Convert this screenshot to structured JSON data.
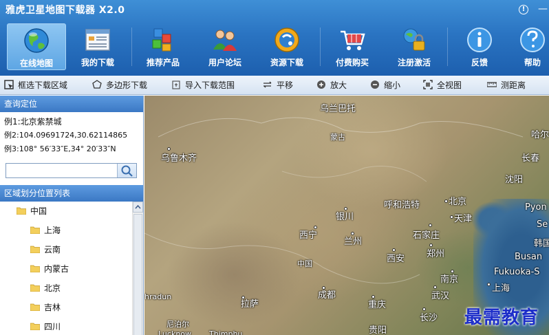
{
  "app": {
    "title": "雅虎卫星地图下载器 X2.0",
    "info_symbol": "!",
    "min_symbol": "—"
  },
  "toolbar": {
    "items": [
      {
        "label": "在线地图",
        "icon": "globe-icon",
        "active": true
      },
      {
        "label": "我的下载",
        "icon": "download-list-icon"
      },
      {
        "label": "推荐产品",
        "icon": "cubes-icon"
      },
      {
        "label": "用户论坛",
        "icon": "users-icon"
      },
      {
        "label": "资源下载",
        "icon": "resource-icon"
      },
      {
        "label": "付费购买",
        "icon": "cart-icon"
      },
      {
        "label": "注册激活",
        "icon": "register-lock-icon"
      },
      {
        "label": "反馈",
        "icon": "info-icon"
      },
      {
        "label": "帮助",
        "icon": "help-icon"
      }
    ]
  },
  "maptools": {
    "items": [
      {
        "label": "框选下载区域",
        "icon": "box-select-icon"
      },
      {
        "label": "多边形下载",
        "icon": "polygon-icon"
      },
      {
        "label": "导入下载范围",
        "icon": "import-icon"
      },
      {
        "label": "平移",
        "icon": "pan-icon"
      },
      {
        "label": "放大",
        "icon": "zoom-in-icon"
      },
      {
        "label": "缩小",
        "icon": "zoom-out-icon"
      },
      {
        "label": "全视图",
        "icon": "full-view-icon"
      },
      {
        "label": "测距离",
        "icon": "ruler-icon"
      }
    ]
  },
  "query": {
    "title": "查询定位",
    "ex1": "例1:北京紫禁城",
    "ex2": "例2:104.09691724,30.62114865",
    "ex3": "例3:108° 56′33″E,34° 20′33″N",
    "search_value": ""
  },
  "region": {
    "title": "区域划分位置列表",
    "root": "中国",
    "children": [
      "上海",
      "云南",
      "内蒙古",
      "北京",
      "吉林",
      "四川"
    ]
  },
  "map": {
    "labels": [
      "乌兰巴托",
      "蒙古",
      "哈尔",
      "乌鲁木齐",
      "长春",
      "沈阳",
      "呼和浩特",
      "北京",
      "银川",
      "天津",
      "Pyon",
      "Se",
      "西宁",
      "兰州",
      "石家庄",
      "韩国",
      "西安",
      "郑州",
      "中国",
      "Busan",
      "Fukuoka-S",
      "南京",
      "上海",
      "hradun",
      "拉萨",
      "成都",
      "重庆",
      "武汉",
      "长沙",
      "尼泊尔",
      "Lucknow",
      "Thimphu",
      "贵阳"
    ],
    "watermark": "最需教育"
  },
  "colors": {
    "header": "#2a74c2",
    "panel_head": "#3b78c4",
    "watermark": "#1d2ec9"
  }
}
